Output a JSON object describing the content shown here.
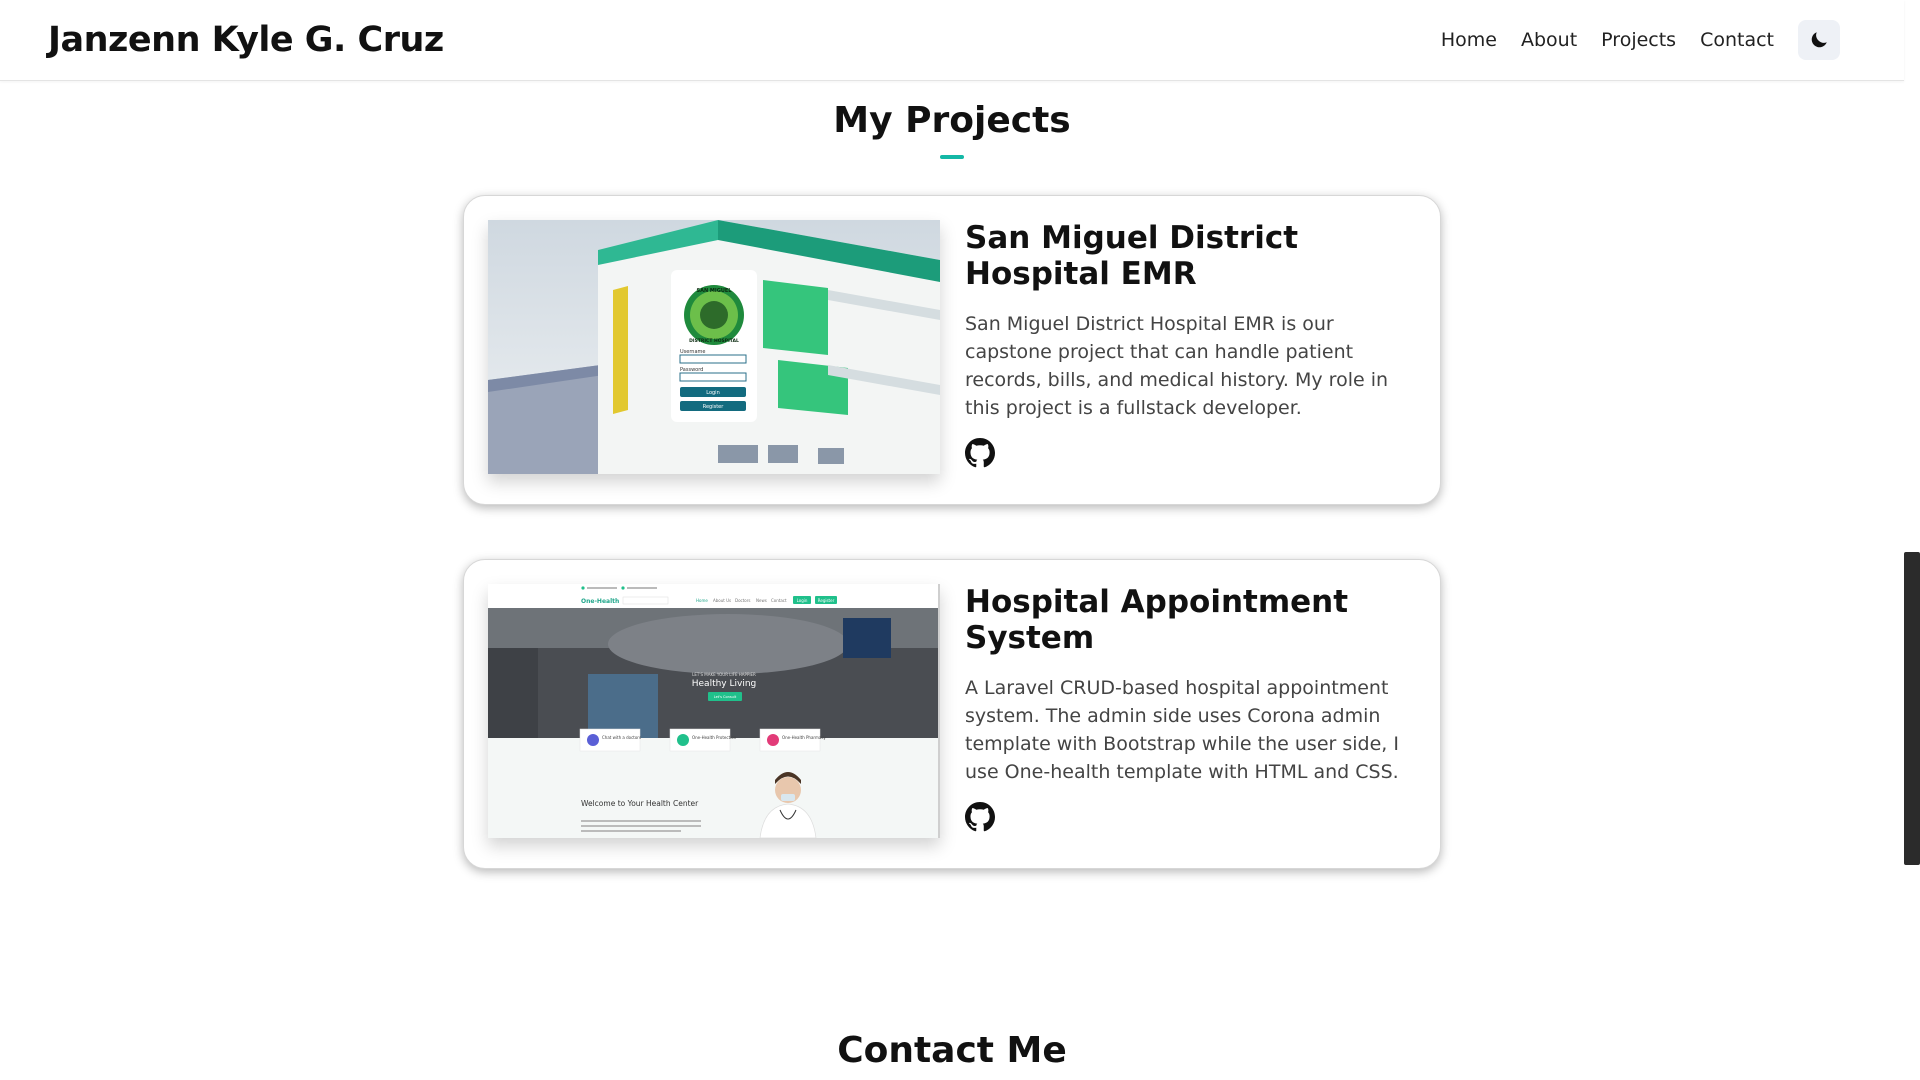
{
  "header": {
    "brand": "Janzenn Kyle G. Cruz",
    "nav": [
      "Home",
      "About",
      "Projects",
      "Contact"
    ],
    "theme_toggle_icon": "moon-icon"
  },
  "projects_section": {
    "title": "My Projects",
    "accent_color": "#14b8a6",
    "projects": [
      {
        "title": "San Miguel District Hospital EMR",
        "description": "San Miguel District Hospital EMR is our capstone project that can handle patient records, bills, and medical history. My role in this project is a fullstack developer.",
        "link_icon": "github-icon",
        "image": {
          "seal_lines": [
            "SAN MIGUEL",
            "DISTRICT HOSPITAL"
          ],
          "username_label": "Username",
          "password_label": "Password",
          "login_label": "Login",
          "register_label": "Register"
        }
      },
      {
        "title": "Hospital Appointment System",
        "description": "A Laravel CRUD-based hospital appointment system. The admin side uses Corona admin template with Bootstrap while the user side, I use One-health template with HTML and CSS.",
        "link_icon": "github-icon",
        "image": {
          "logo": "One-Health",
          "nav": [
            "Home",
            "About Us",
            "Doctors",
            "News",
            "Contact"
          ],
          "login": "Login",
          "register": "Register",
          "hero_small": "LET'S MAKE YOUR LIFE HAPPIER",
          "hero_title": "Healthy Living",
          "hero_button": "Let's Consult",
          "features": [
            "Chat with a doctors",
            "One-Health Protection",
            "One-Health Pharmacy"
          ],
          "welcome": "Welcome to Your Health Center"
        }
      }
    ]
  },
  "contact_section": {
    "title": "Contact Me"
  }
}
